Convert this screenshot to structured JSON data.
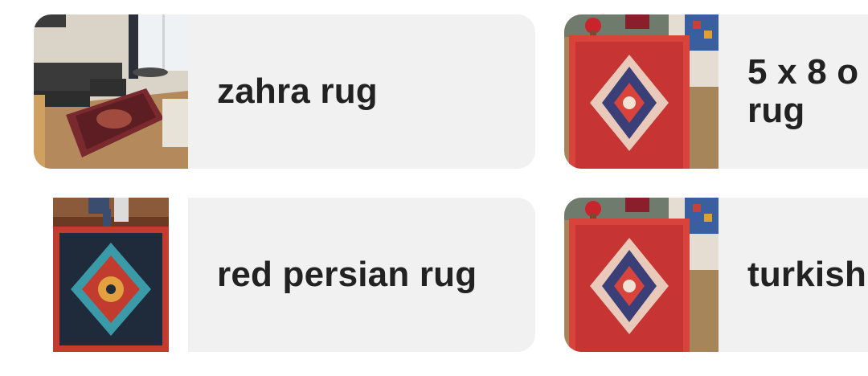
{
  "suggestions": [
    {
      "label": "zahra rug",
      "image": "living-room-rug-photo"
    },
    {
      "label": "5 x 8 o\nrug",
      "image": "red-heriz-rug-photo"
    },
    {
      "label": "red persian rug",
      "image": "persian-medallion-rug-photo"
    },
    {
      "label": "turkish",
      "image": "red-heriz-rug-photo"
    }
  ],
  "colors": {
    "card_bg": "#f1f1f1",
    "text": "#222222"
  }
}
